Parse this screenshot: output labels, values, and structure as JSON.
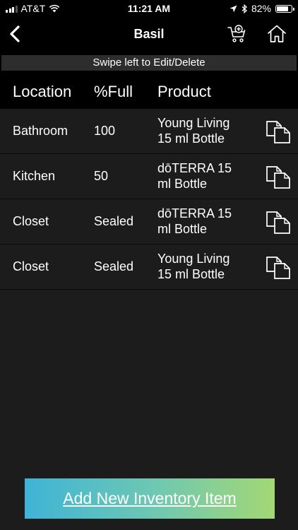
{
  "status_bar": {
    "carrier": "AT&T",
    "time": "11:21 AM",
    "battery_percent": "82%",
    "battery_level": 0.82
  },
  "nav": {
    "title": "Basil",
    "back_icon": "chevron-left-icon",
    "cart_icon": "cart-add-icon",
    "home_icon": "home-icon"
  },
  "hint": "Swipe left to Edit/Delete",
  "table": {
    "columns": [
      "Location",
      "%Full",
      "Product"
    ],
    "rows": [
      {
        "location": "Bathroom",
        "full": "100",
        "product_line1": "Young Living",
        "product_line2": "15 ml Bottle"
      },
      {
        "location": "Kitchen",
        "full": "50",
        "product_line1": "dōTERRA 15",
        "product_line2": "ml Bottle"
      },
      {
        "location": "Closet",
        "full": "Sealed",
        "product_line1": "dōTERRA 15",
        "product_line2": "ml Bottle"
      },
      {
        "location": "Closet",
        "full": "Sealed",
        "product_line1": "Young Living",
        "product_line2": "15 ml Bottle"
      }
    ]
  },
  "add_button": {
    "label": "Add New Inventory Item"
  },
  "colors": {
    "background": "#000000",
    "table_body": "#1c1c1c",
    "hint_bar": "#2d2d2d",
    "button_gradient_start": "#3fb4d6",
    "button_gradient_end": "#a3d874"
  }
}
